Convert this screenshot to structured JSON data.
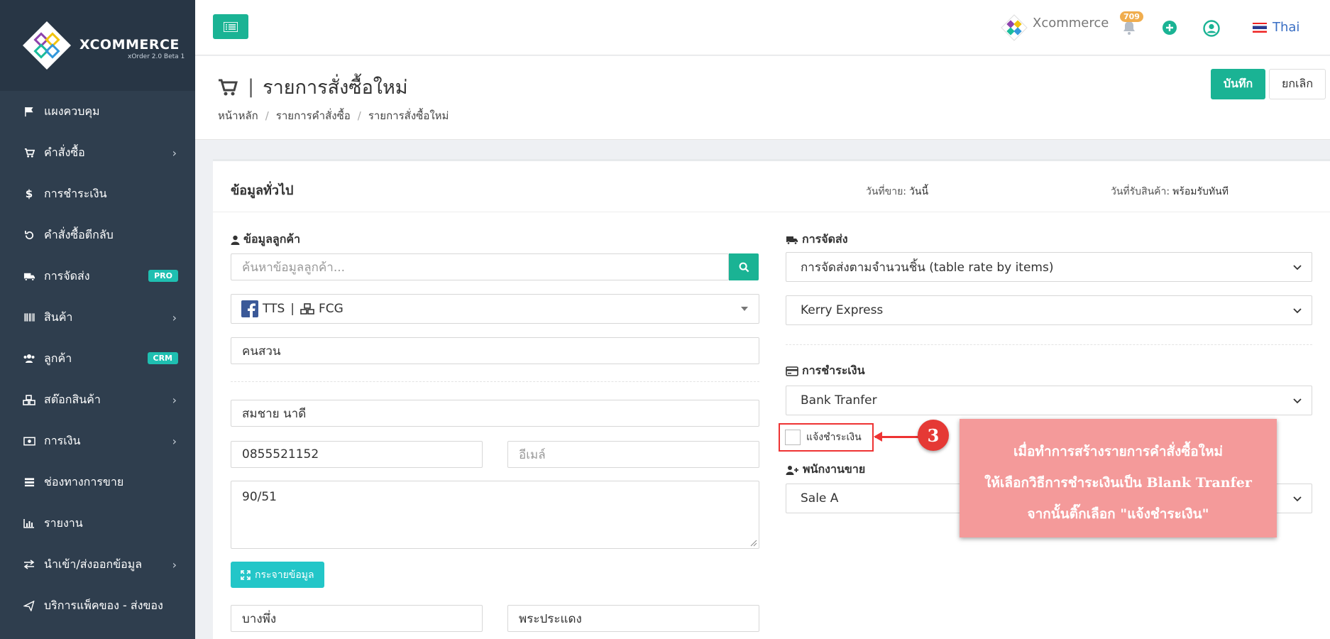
{
  "brand": {
    "logo_title": "XCOMMERCE",
    "logo_sub": "xOrder 2.0 Beta 1",
    "topbar_name": "Xcommerce"
  },
  "topbar": {
    "notification_count": "709",
    "language": "Thai"
  },
  "sidebar": {
    "items": [
      {
        "label": "แผงควบคุม",
        "icon": "flag-icon"
      },
      {
        "label": "คำสั่งซื้อ",
        "icon": "cart-icon",
        "has_children": true
      },
      {
        "label": "การชำระเงิน",
        "icon": "dollar-icon"
      },
      {
        "label": "คำสั่งซื้อตีกลับ",
        "icon": "undo-icon"
      },
      {
        "label": "การจัดส่ง",
        "icon": "truck-icon",
        "badge": "PRO"
      },
      {
        "label": "สินค้า",
        "icon": "barcode-icon",
        "has_children": true
      },
      {
        "label": "ลูกค้า",
        "icon": "users-icon",
        "badge": "CRM"
      },
      {
        "label": "สต๊อกสินค้า",
        "icon": "cubes-icon",
        "has_children": true
      },
      {
        "label": "การเงิน",
        "icon": "money-icon",
        "has_children": true
      },
      {
        "label": "ช่องทางการขาย",
        "icon": "list-icon"
      },
      {
        "label": "รายงาน",
        "icon": "chart-icon"
      },
      {
        "label": "นำเข้า/ส่งออกข้อมูล",
        "icon": "exchange-icon",
        "has_children": true
      },
      {
        "label": "บริการแพ็คของ - ส่งของ",
        "icon": "send-icon"
      }
    ]
  },
  "page": {
    "title": "รายการสั่งซื้อใหม่",
    "breadcrumb": [
      "หน้าหลัก",
      "รายการคำสั่งซื้อ",
      "รายการสั่งซื้อใหม่"
    ],
    "save_label": "บันทึก",
    "cancel_label": "ยกเลิก"
  },
  "card": {
    "title": "ข้อมูลทั่วไป",
    "sale_date_label": "วันที่ขาย:",
    "sale_date_value": "วันนี้",
    "receive_date_label": "วันที่รับสินค้า:",
    "receive_date_value": "พร้อมรับทันที"
  },
  "customer": {
    "section_label": "ข้อมูลลูกค้า",
    "search_placeholder": "ค้นหาข้อมูลลูกค้า...",
    "channel_page": "TTS",
    "channel_group": "FCG",
    "channel_separator": "|",
    "nickname": "คนสวน",
    "fullname": "สมชาย  นาดี",
    "phone": "0855521152",
    "email_placeholder": "อีเมล์",
    "address": "90/51",
    "expand_button": "กระจายข้อมูล",
    "subdistrict": "บางพึ่ง",
    "district": "พระประแดง"
  },
  "shipping": {
    "section_label": "การจัดส่ง",
    "method": "การจัดส่งตามจำนวนชิ้น (table rate by items)",
    "carrier": "Kerry Express"
  },
  "payment": {
    "section_label": "การชำระเงิน",
    "method": "Bank Tranfer",
    "notify_label": "แจ้งชำระเงิน"
  },
  "sales": {
    "section_label": "พนักงานขาย",
    "staff": "Sale A"
  },
  "annotation": {
    "step": "3",
    "lines": [
      "เมื่อทำการสร้างรายการคำสั่งซื้อใหม่",
      "ให้เลือกวิธีการชำระเงินเป็น Blank Tranfer",
      "จากนั้นติ๊กเลือก \"แจ้งชำระเงิน\""
    ]
  }
}
